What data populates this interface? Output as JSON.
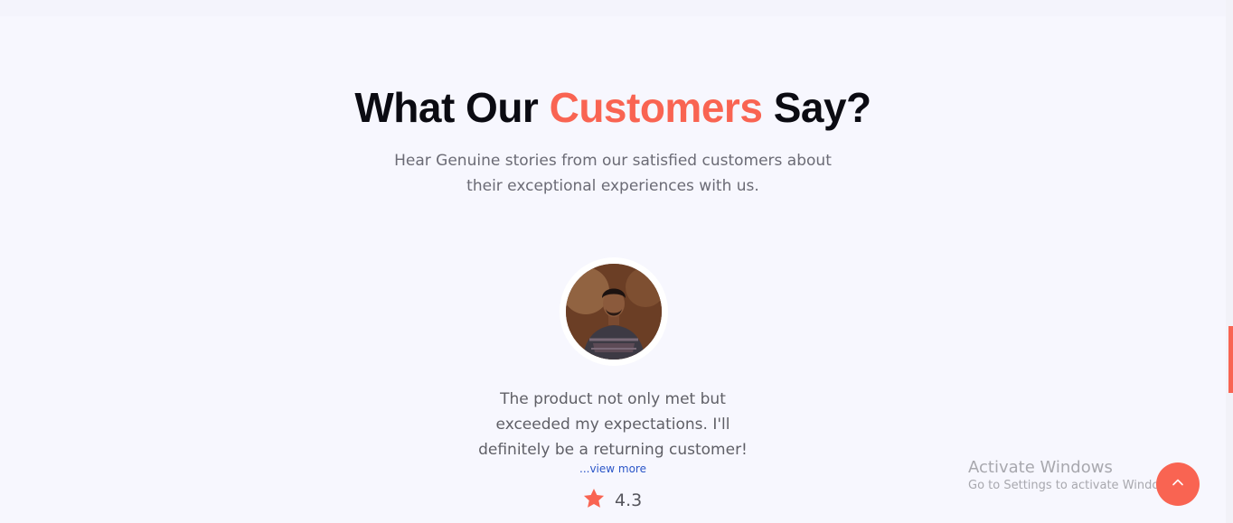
{
  "section": {
    "heading_prefix": "What Our",
    "heading_accent": "Customers",
    "heading_suffix": "Say?",
    "subtitle_line1": "Hear Genuine stories from our satisfied customers about",
    "subtitle_line2": "their exceptional experiences with us."
  },
  "testimonial": {
    "quote_line1": "The product not only met but",
    "quote_line2": "exceeded my expectations. I'll",
    "quote_line3": "definitely be a returning customer!",
    "view_more": "...view more",
    "rating": "4.3",
    "rating_icon": "star-icon",
    "avatar_icon": "customer-avatar"
  },
  "windows_notice": {
    "title": "Activate Windows",
    "hint": "Go to Settings to activate Windows."
  },
  "scroll_top": {
    "icon": "chevron-up-icon"
  },
  "colors": {
    "accent": "#f96452",
    "background": "#f7f7fe",
    "heading": "#0b0b12",
    "link": "#2b56c8"
  }
}
